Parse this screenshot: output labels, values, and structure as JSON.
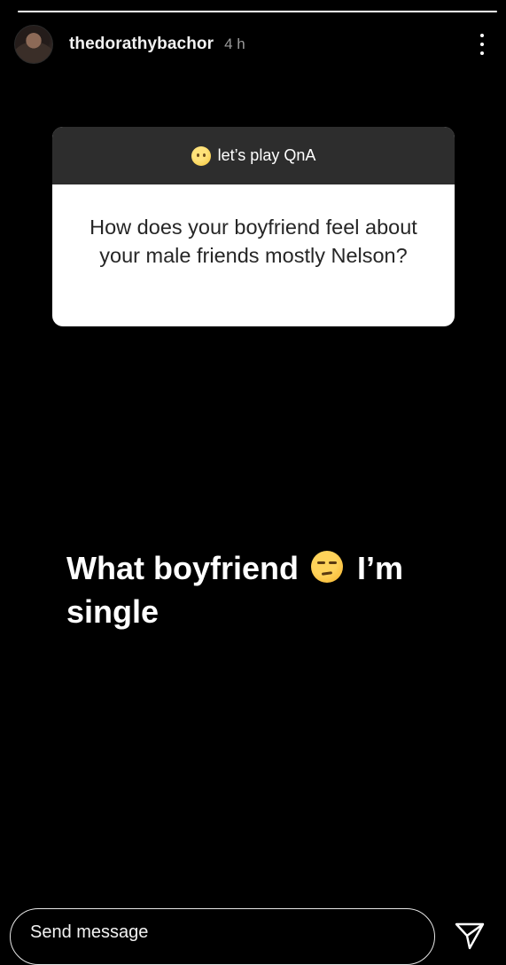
{
  "story": {
    "progress_segments": 1
  },
  "header": {
    "username": "thedorathybachor",
    "time_ago": "4 h"
  },
  "question_sticker": {
    "prompt_emoji": "hushed-face-emoji",
    "prompt": "let’s play QnA",
    "question": "How does your boyfriend feel about your male friends mostly Nelson?"
  },
  "caption": {
    "text_before": "What boyfriend",
    "emoji": "unamused-face-emoji",
    "text_after": "I’m single"
  },
  "footer": {
    "message_placeholder": "Send message"
  },
  "icons": {
    "more": "more-options-icon",
    "send": "paper-plane-icon"
  },
  "colors": {
    "background": "#000000",
    "card_header": "#2d2d2d",
    "card_body": "#ffffff",
    "secondary_text": "#9a9a9a"
  }
}
